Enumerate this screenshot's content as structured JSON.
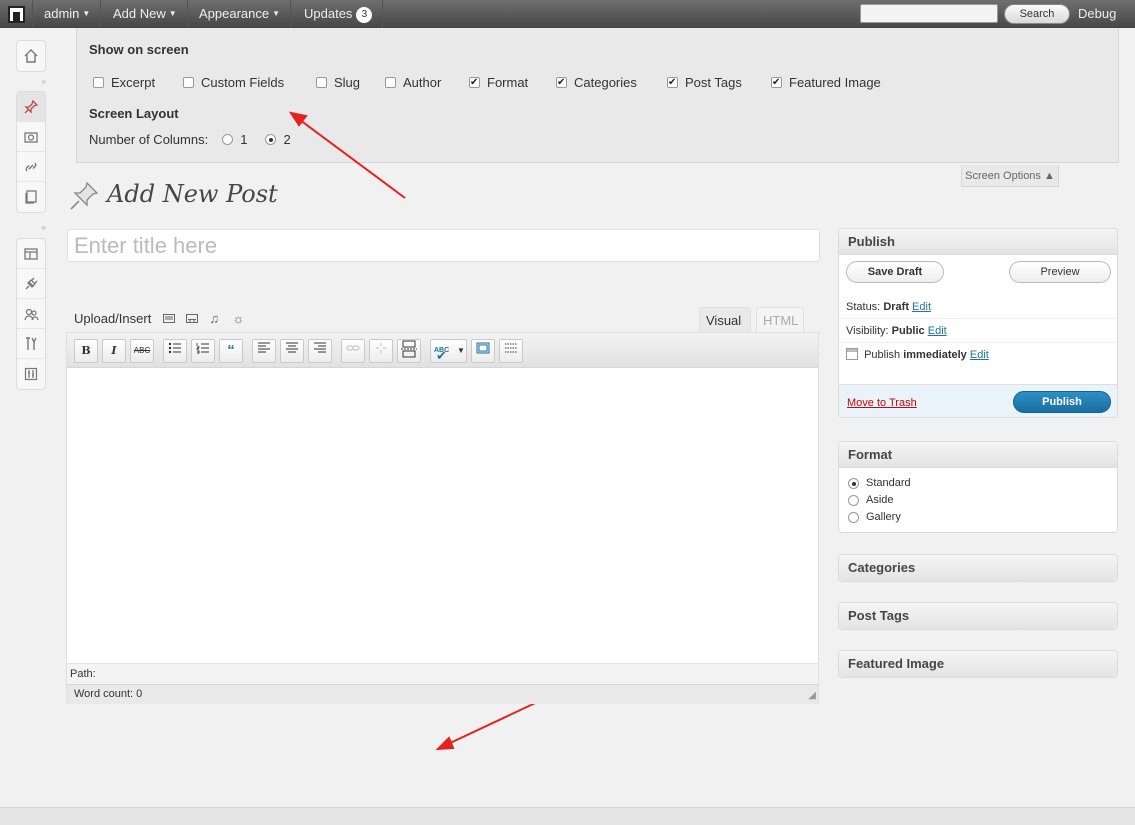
{
  "adminbar": {
    "user": "admin",
    "add_new": "Add New",
    "appearance": "Appearance",
    "updates": "Updates",
    "updates_count": "3",
    "search_button": "Search",
    "debug": "Debug",
    "search_value": ""
  },
  "screen_options": {
    "show_heading": "Show on screen",
    "checkboxes": [
      {
        "label": "Excerpt",
        "checked": false
      },
      {
        "label": "Custom Fields",
        "checked": false
      },
      {
        "label": "Slug",
        "checked": false
      },
      {
        "label": "Author",
        "checked": false
      },
      {
        "label": "Format",
        "checked": true
      },
      {
        "label": "Categories",
        "checked": true
      },
      {
        "label": "Post Tags",
        "checked": true
      },
      {
        "label": "Featured Image",
        "checked": true
      }
    ],
    "layout_heading": "Screen Layout",
    "columns_label": "Number of Columns:",
    "column_options": [
      "1",
      "2"
    ],
    "columns_selected": "2",
    "tab_label": "Screen Options ▲"
  },
  "page": {
    "title": "Add New Post",
    "title_placeholder": "Enter title here"
  },
  "editor": {
    "upload_insert": "Upload/Insert",
    "tab_visual": "Visual",
    "tab_html": "HTML",
    "toolbar": {
      "bold": "B",
      "italic": "I",
      "strike": "ABC"
    },
    "path_label": "Path:",
    "word_count": "Word count: 0"
  },
  "publish": {
    "heading": "Publish",
    "save_draft": "Save Draft",
    "preview": "Preview",
    "status_label": "Status:",
    "status_value": "Draft",
    "visibility_label": "Visibility:",
    "visibility_value": "Public",
    "schedule_label": "Publish",
    "schedule_value": "immediately",
    "edit": "Edit",
    "move_to_trash": "Move to Trash",
    "publish_button": "Publish"
  },
  "format": {
    "heading": "Format",
    "options": [
      "Standard",
      "Aside",
      "Gallery"
    ],
    "selected": "Standard"
  },
  "boxes": {
    "categories": "Categories",
    "post_tags": "Post Tags",
    "featured_image": "Featured Image"
  },
  "colors": {
    "annotation_arrow": "#e82020",
    "publish_button": "#21759b",
    "link": "#21759b",
    "trash": "#bc0b0b"
  }
}
